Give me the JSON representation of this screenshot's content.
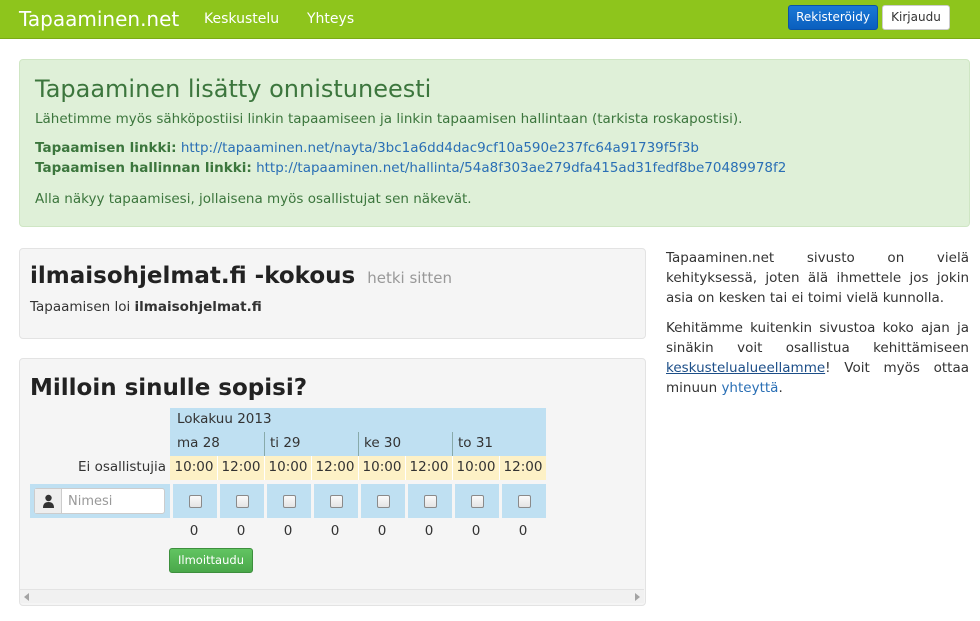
{
  "navbar": {
    "brand": "Tapaaminen.net",
    "links": [
      "Keskustelu",
      "Yhteys"
    ],
    "register_label": "Rekisteröidy",
    "login_label": "Kirjaudu"
  },
  "alert": {
    "title": "Tapaaminen lisätty onnistuneesti",
    "message": "Lähetimme myös sähköpostiisi linkin tapaamiseen ja linkin tapaamisen hallintaan (tarkista roskapostisi).",
    "meeting_link_label": "Tapaamisen linkki:",
    "meeting_link_url": "http://tapaaminen.net/nayta/3bc1a6dd4dac9cf10a590e237fc64a91739f5f3b",
    "admin_link_label": "Tapaamisen hallinnan linkki:",
    "admin_link_url": "http://tapaaminen.net/hallinta/54a8f303ae279dfa415ad31fedf8be70489978f2",
    "footer": "Alla näkyy tapaamisesi, jollaisena myös osallistujat sen näkevät."
  },
  "meeting": {
    "title": "ilmaisohjelmat.fi -kokous",
    "time_ago": "hetki sitten",
    "creator_prefix": "Tapaamisen loi",
    "creator_name": "ilmaisohjelmat.fi"
  },
  "schedule": {
    "title": "Milloin sinulle sopisi?",
    "month": "Lokakuu 2013",
    "days": [
      "ma 28",
      "ti 29",
      "ke 30",
      "to 31"
    ],
    "times": [
      "10:00",
      "12:00",
      "10:00",
      "12:00",
      "10:00",
      "12:00",
      "10:00",
      "12:00"
    ],
    "no_participants_label": "Ei osallistujia",
    "name_placeholder": "Nimesi",
    "counts": [
      "0",
      "0",
      "0",
      "0",
      "0",
      "0",
      "0",
      "0"
    ],
    "signup_label": "Ilmoittaudu"
  },
  "sidebar": {
    "p1": "Tapaaminen.net sivusto on vielä kehityksessä, joten älä ihmettele jos jokin asia on kesken tai ei toimi vielä kunnolla.",
    "p2_start": "Kehitämme kuitenkin sivustoa koko ajan ja sinäkin voit osallistua kehittämiseen",
    "p2_link": "keskustelualueellamme",
    "p2_middle": "! Voit myös ottaa minuun",
    "p2_link2": "yhteyttä",
    "p2_end": "."
  },
  "colors": {
    "navbar": "#8ec51c",
    "alert_bg": "#dff0d8",
    "alert_text": "#3c763d",
    "link": "#2a6fb5",
    "grid_blue": "#bfe0f2",
    "grid_yellow": "#fdf1c6",
    "register_button": "#0a5fbf",
    "signup_button": "#4aa84a"
  }
}
